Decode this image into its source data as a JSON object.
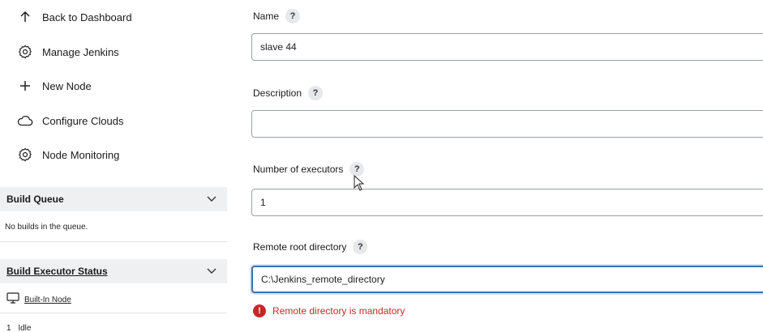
{
  "sidebar": {
    "items": [
      {
        "label": "Back to Dashboard",
        "icon": "arrow-up-icon"
      },
      {
        "label": "Manage Jenkins",
        "icon": "gear-icon"
      },
      {
        "label": "New Node",
        "icon": "plus-icon"
      },
      {
        "label": "Configure Clouds",
        "icon": "cloud-icon"
      },
      {
        "label": "Node Monitoring",
        "icon": "gear-icon"
      }
    ],
    "build_queue": {
      "title": "Build Queue",
      "text": "No builds in the queue."
    },
    "executor_status": {
      "title": "Build Executor Status",
      "node_label": "Built-In Node",
      "executor_number": "1",
      "executor_state": "Idle"
    }
  },
  "form": {
    "help_label": "?",
    "name": {
      "label": "Name",
      "value": "slave 44"
    },
    "description": {
      "label": "Description",
      "value": ""
    },
    "executors": {
      "label": "Number of executors",
      "value": "1"
    },
    "remote_root": {
      "label": "Remote root directory",
      "value": "C:\\Jenkins_remote_directory"
    },
    "error": {
      "icon_glyph": "!",
      "message": "Remote directory is mandatory"
    }
  },
  "colors": {
    "error": "#c62828",
    "focus_border": "#3c6fae",
    "panel_bg": "#eef0f2"
  }
}
